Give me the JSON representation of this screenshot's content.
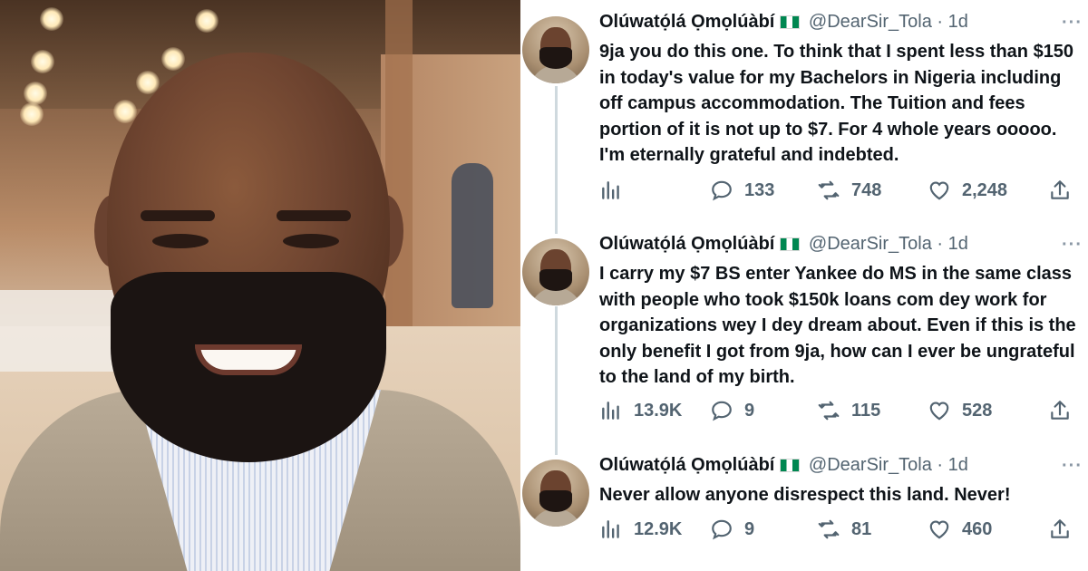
{
  "photo": {
    "alt": "smiling bearded man photo"
  },
  "tweets": [
    {
      "name": "Olúwatọ́lá Ọmọlúàbí",
      "handle": "@DearSir_Tola",
      "separator": "·",
      "time": "1d",
      "more": "···",
      "text": "9ja you do this one. To think that I spent less than $150 in today's value for my Bachelors in Nigeria including off campus accommodation. The Tuition and fees portion of it is not up to $7. For 4 whole years ooooo. I'm eternally grateful and indebted.",
      "views": "",
      "replies": "133",
      "retweets": "748",
      "likes": "2,248"
    },
    {
      "name": "Olúwatọ́lá Ọmọlúàbí",
      "handle": "@DearSir_Tola",
      "separator": "·",
      "time": "1d",
      "more": "···",
      "text": "I carry my $7 BS enter Yankee do MS in the same class with people who took $150k loans com dey work for organizations wey I dey dream about. Even if this is the only benefit I got from 9ja, how can I ever be ungrateful to the land of my birth.",
      "views": "13.9K",
      "replies": "9",
      "retweets": "115",
      "likes": "528"
    },
    {
      "name": "Olúwatọ́lá Ọmọlúàbí",
      "handle": "@DearSir_Tola",
      "separator": "·",
      "time": "1d",
      "more": "···",
      "text": "Never allow anyone disrespect this land. Never!",
      "views": "12.9K",
      "replies": "9",
      "retweets": "81",
      "likes": "460"
    }
  ],
  "colors": {
    "text": "#0f1419",
    "muted": "#536471",
    "thread": "#cfd9de"
  },
  "icons": [
    "views-icon",
    "reply-icon",
    "retweet-icon",
    "like-icon",
    "share-icon",
    "nigeria-flag-icon"
  ]
}
